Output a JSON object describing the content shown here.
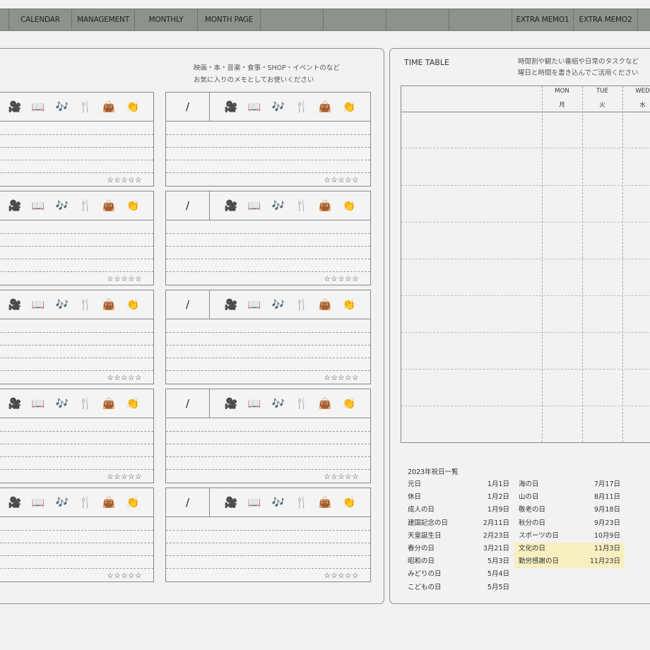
{
  "nav": {
    "tabs": [
      "CALENDAR",
      "MANAGEMENT",
      "MONTHLY",
      "MONTH PAGE",
      "EXTRA MEMO1",
      "EXTRA MEMO2"
    ]
  },
  "memo": {
    "note_lines": [
      "映画・本・音楽・食事・SHOP・イベントのなど",
      "お気に入りのメモとしてお使いください"
    ],
    "date_slash": "/",
    "icons": [
      {
        "name": "movie-camera-icon",
        "glyph": "🎥"
      },
      {
        "name": "book-icon",
        "glyph": "📖"
      },
      {
        "name": "music-note-icon",
        "glyph": "🎶"
      },
      {
        "name": "fork-knife-icon",
        "glyph": "🍴"
      },
      {
        "name": "handbag-icon",
        "glyph": "👜"
      },
      {
        "name": "clapping-hands-icon",
        "glyph": "👏"
      }
    ],
    "stars": "☆☆☆☆☆",
    "rating_stars": 0
  },
  "timetable": {
    "title": "TIME TABLE",
    "note_lines": [
      "時間割や観たい番組や日常のタスクなど",
      "曜日と時間を書き込んでご活用ください"
    ],
    "days": [
      {
        "en": "MON",
        "jp": "月"
      },
      {
        "en": "TUE",
        "jp": "火"
      },
      {
        "en": "WED",
        "jp": "水"
      }
    ]
  },
  "holidays": {
    "title": "2023年祝日一覧",
    "left": [
      {
        "name": "元日",
        "date": "1月1日"
      },
      {
        "name": "休日",
        "date": "1月2日"
      },
      {
        "name": "成人の日",
        "date": "1月9日"
      },
      {
        "name": "建国記念の日",
        "date": "2月11日"
      },
      {
        "name": "天皇誕生日",
        "date": "2月23日"
      },
      {
        "name": "春分の日",
        "date": "3月21日"
      },
      {
        "name": "昭和の日",
        "date": "5月3日"
      },
      {
        "name": "みどりの日",
        "date": "5月4日"
      },
      {
        "name": "こどもの日",
        "date": "5月5日"
      }
    ],
    "right": [
      {
        "name": "海の日",
        "date": "7月17日",
        "highlight": false
      },
      {
        "name": "山の日",
        "date": "8月11日",
        "highlight": false
      },
      {
        "name": "敬老の日",
        "date": "9月18日",
        "highlight": false
      },
      {
        "name": "秋分の日",
        "date": "9月23日",
        "highlight": false
      },
      {
        "name": "スポーツの日",
        "date": "10月9日",
        "highlight": false
      },
      {
        "name": "文化の日",
        "date": "11月3日",
        "highlight": true
      },
      {
        "name": "勤労感謝の日",
        "date": "11月23日",
        "highlight": true
      }
    ],
    "highlight_color": "#f7efc0"
  }
}
